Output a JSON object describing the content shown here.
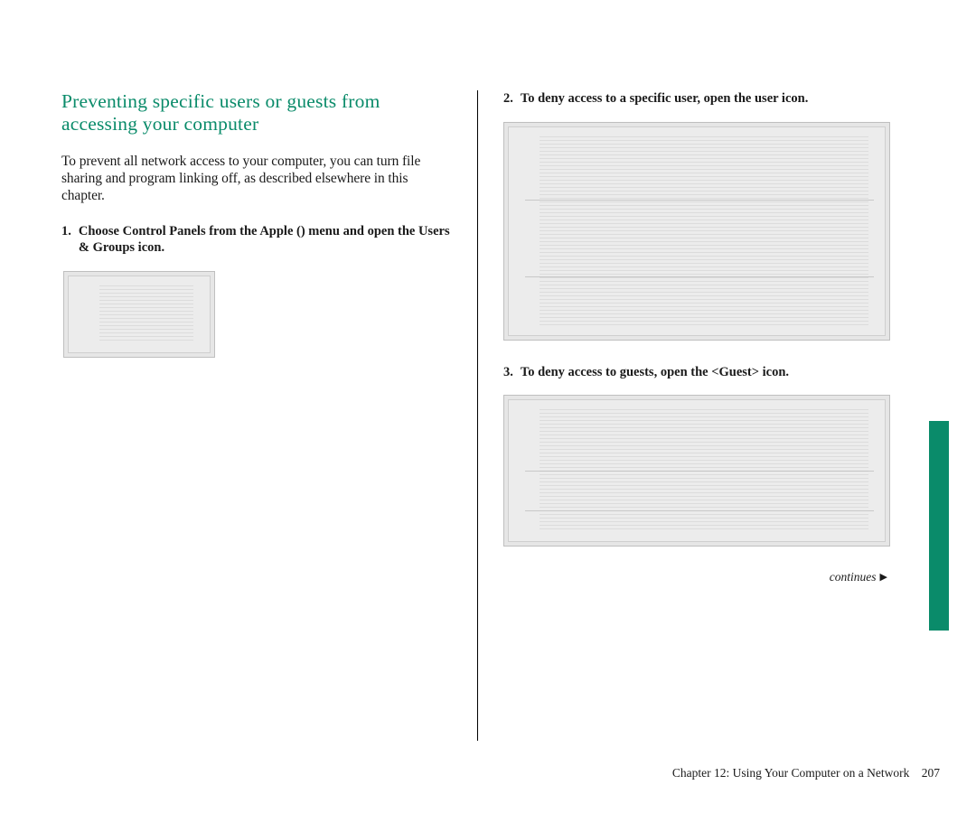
{
  "heading": "Preventing specific users or guests from accessing your computer",
  "intro": "To prevent all network access to your computer, you can turn file sharing and program linking off, as described elsewhere in this chapter.",
  "steps": {
    "s1": {
      "num": "1.",
      "text_a": "Choose Control Panels from the Apple (",
      "apple": "",
      "text_b": ") menu and open the Users & Groups icon."
    },
    "s2": {
      "num": "2.",
      "text": "To deny access to a specific user, open the user icon."
    },
    "s3": {
      "num": "3.",
      "text": "To deny access to guests, open the <Guest> icon."
    }
  },
  "continues_label": "continues",
  "footer": {
    "chapter": "Chapter 12: Using Your Computer on a Network",
    "page": "207"
  }
}
